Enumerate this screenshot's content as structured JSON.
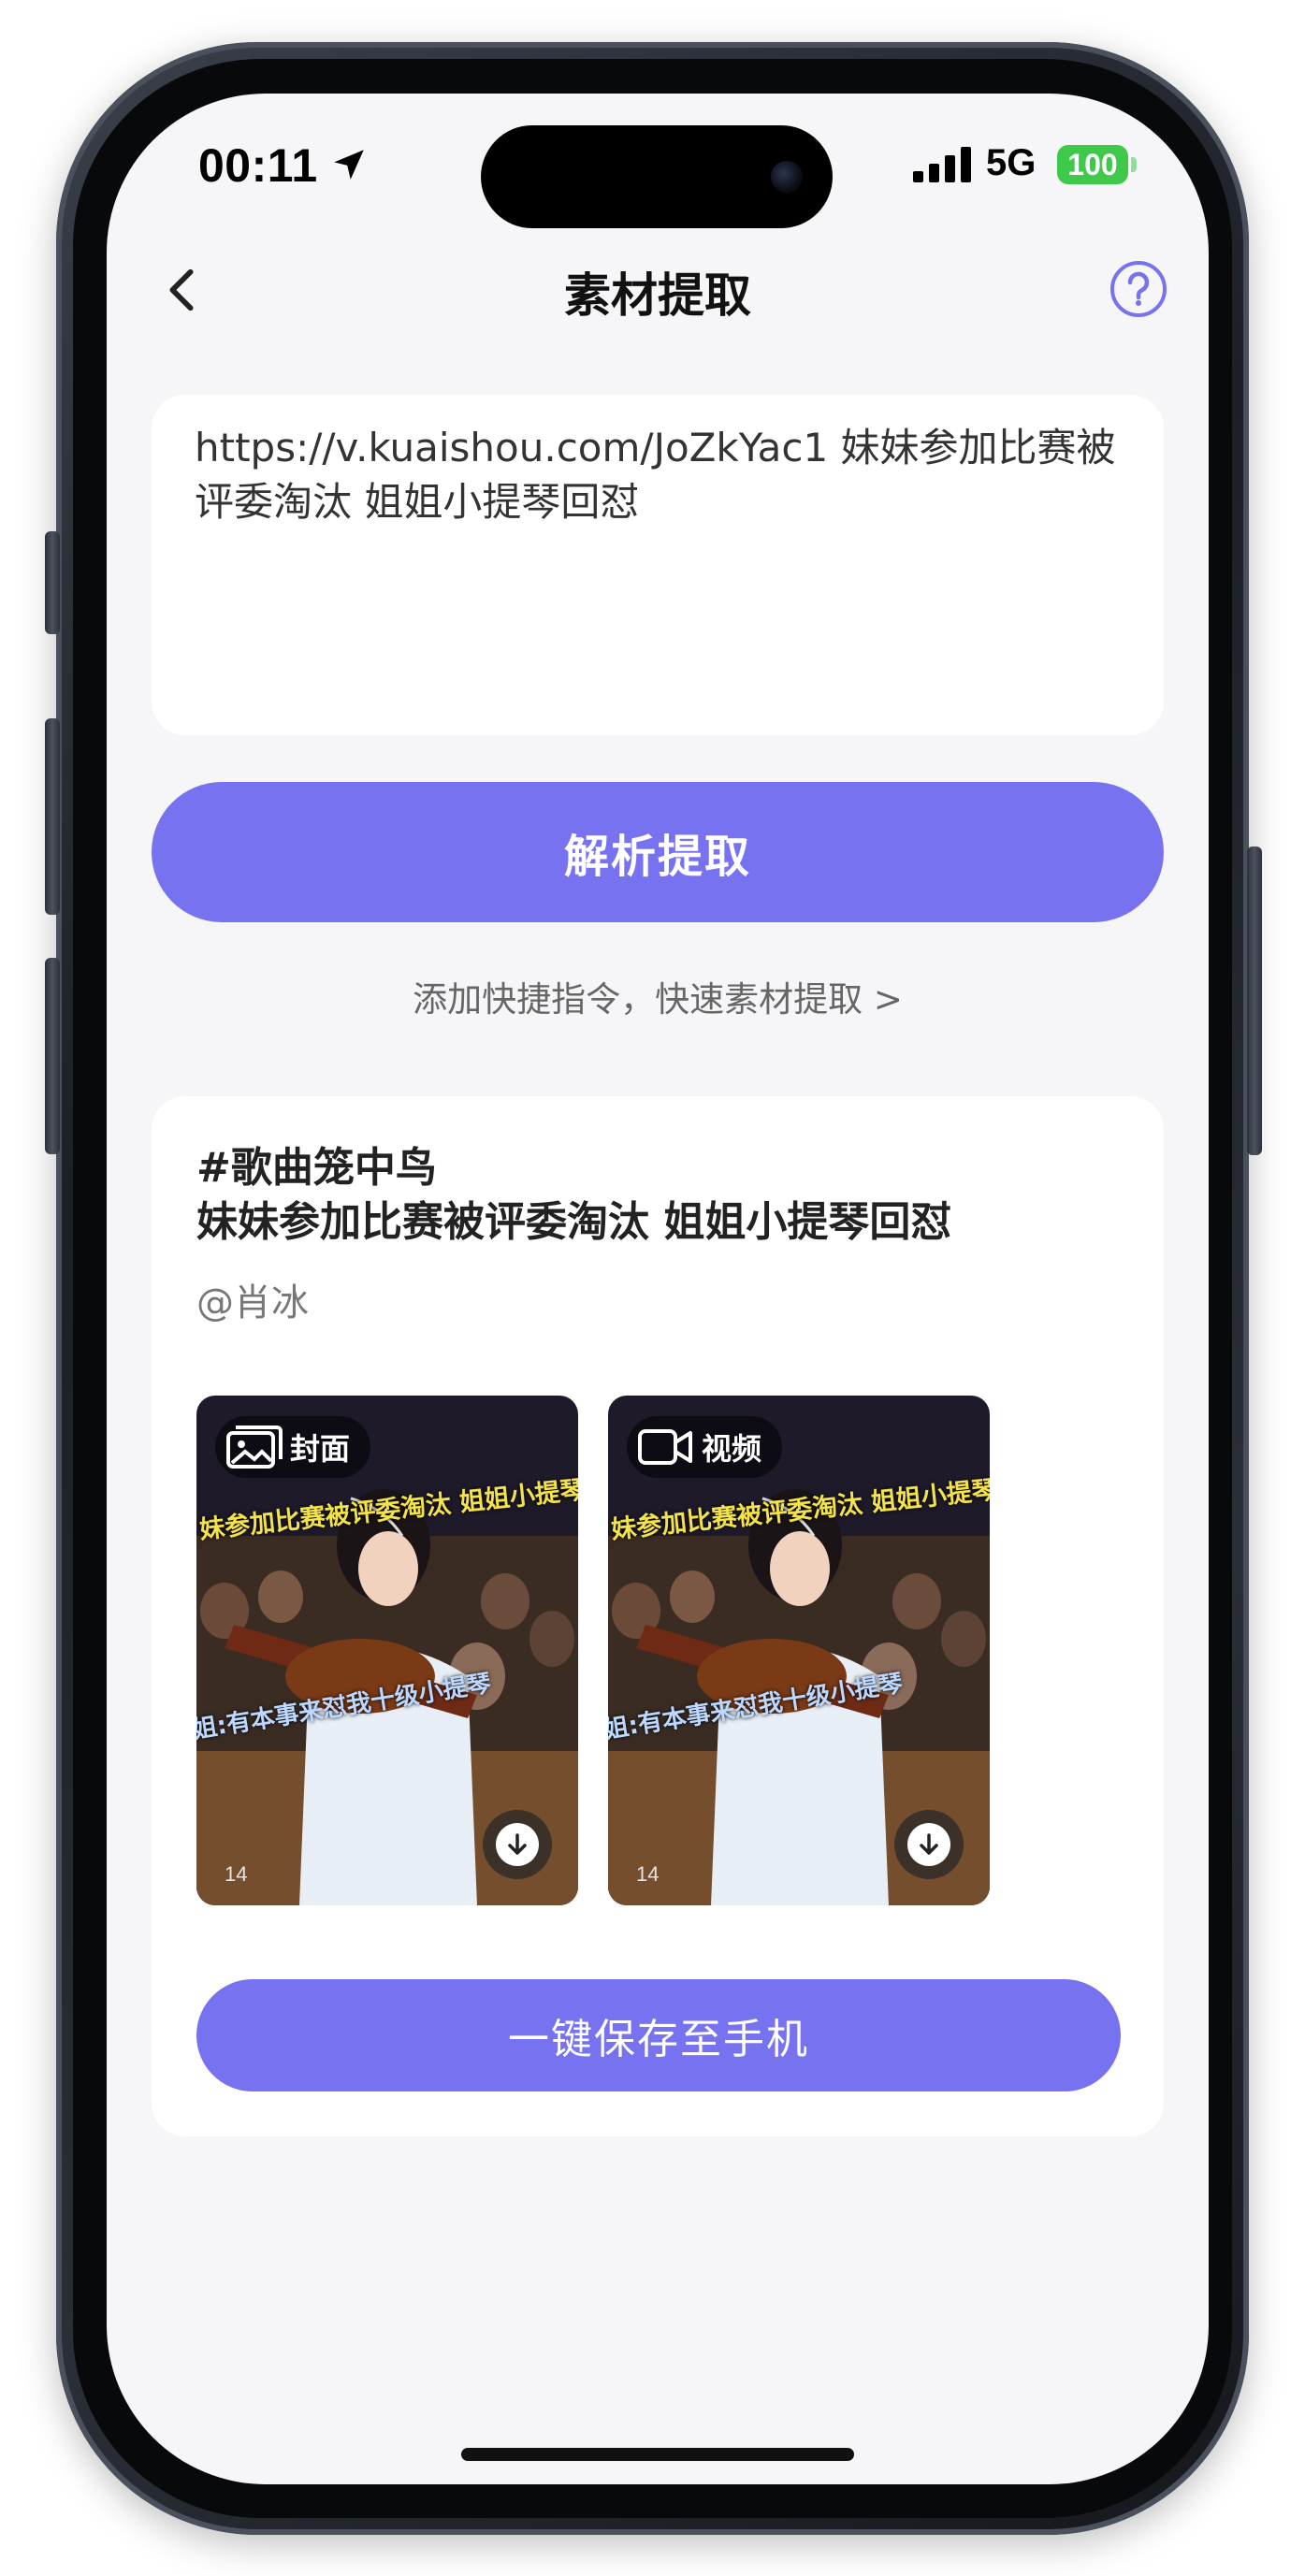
{
  "status_bar": {
    "time": "00:11",
    "network": "5G",
    "battery": "100"
  },
  "nav": {
    "title": "素材提取"
  },
  "link_input": {
    "value": "https://v.kuaishou.com/JoZkYac1 妹妹参加比赛被评委淘汰 姐姐小提琴回怼"
  },
  "parse_button": "解析提取",
  "shortcut_link": "添加快捷指令，快速素材提取 >",
  "result": {
    "title_line1": "#歌曲笼中鸟",
    "title_line2": "妹妹参加比赛被评委淘汰 姐姐小提琴回怼",
    "author": "@肖冰",
    "media": [
      {
        "tag": "封面",
        "icon": "image-icon",
        "overlay_top": "妹参加比赛被评委淘汰 姐姐小提琴",
        "overlay_mid": "姐:有本事来怼我十级小提琴",
        "counter": "14"
      },
      {
        "tag": "视频",
        "icon": "video-icon",
        "overlay_top": "妹参加比赛被评委淘汰 姐姐小提琴",
        "overlay_mid": "姐:有本事来怼我十级小提琴",
        "counter": "14"
      }
    ],
    "save_button": "一键保存至手机"
  },
  "colors": {
    "accent": "#7672f0",
    "battery": "#3ec94a",
    "background": "#f6f6f9"
  }
}
